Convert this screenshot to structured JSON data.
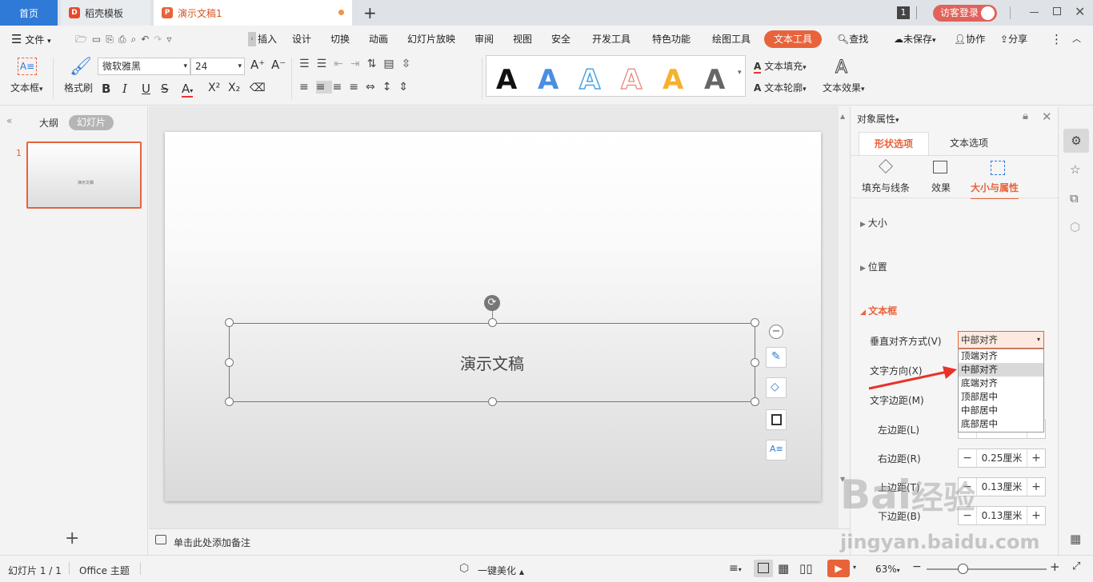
{
  "tabs": {
    "home": "首页",
    "template": "稻壳模板",
    "doc": "演示文稿1",
    "new_tab": "+"
  },
  "titlebar": {
    "badge": "1",
    "login": "访客登录"
  },
  "menu": {
    "file": "文件",
    "items": [
      "插入",
      "设计",
      "切换",
      "动画",
      "幻灯片放映",
      "审阅",
      "视图",
      "安全",
      "开发工具",
      "特色功能",
      "绘图工具",
      "文本工具"
    ],
    "search": "查找",
    "unsaved": "未保存",
    "collab": "协作",
    "share": "分享"
  },
  "ribbon": {
    "textbox": "文本框",
    "format_painter": "格式刷",
    "font": "微软雅黑",
    "size": "24",
    "text_fill": "文本填充",
    "text_outline": "文本轮廓",
    "text_effect": "文本效果",
    "style_letter": "A"
  },
  "left": {
    "outline": "大纲",
    "slides": "幻灯片",
    "slide_num": "1",
    "thumb_text": "演示文稿",
    "add": "+"
  },
  "slide": {
    "text": "演示文稿"
  },
  "notes": {
    "hint": "单击此处添加备注"
  },
  "panel": {
    "title": "对象属性",
    "tab_shape": "形状选项",
    "tab_text": "文本选项",
    "sub_fill": "填充与线条",
    "sub_effect": "效果",
    "sub_size": "大小与属性",
    "section_size": "大小",
    "section_position": "位置",
    "section_textbox": "文本框",
    "valign_label": "垂直对齐方式(V)",
    "valign_value": "中部对齐",
    "dropdown_options": [
      "顶端对齐",
      "中部对齐",
      "底端对齐",
      "顶部居中",
      "中部居中",
      "底部居中"
    ],
    "dropdown_selected_index": 1,
    "direction_label": "文字方向(X)",
    "margin_label": "文字边距(M)",
    "left_margin": "左边距(L)",
    "right_margin": "右边距(R)",
    "right_value": "0.25厘米",
    "top_margin": "上边距(T)",
    "top_value": "0.13厘米",
    "bottom_margin": "下边距(B)",
    "bottom_value": "0.13厘米",
    "minus": "−",
    "plus": "+"
  },
  "status": {
    "slide_info": "幻灯片 1 / 1",
    "theme": "Office 主题",
    "beautify": "一键美化",
    "zoom": "63%"
  },
  "colors": {
    "accent": "#e8633a",
    "blue": "#2f7ad6",
    "arrow": "#e8332a"
  },
  "watermark": {
    "text1": "Bai",
    "text2": "经验",
    "url": "jingyan.baidu.com"
  }
}
